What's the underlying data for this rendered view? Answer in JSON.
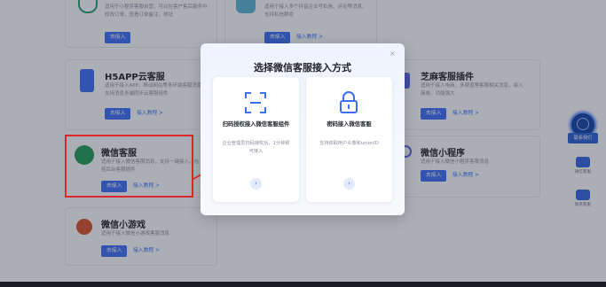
{
  "cards": {
    "top_left": {
      "desc": "适用于小程序客服自营，可以在客户售后服务中修改订单、查看订单备注、地址"
    },
    "top_mid": {
      "desc": "适用于接入多个抖音企业号私信、评论等消息，支持私信群发"
    },
    "h5app": {
      "title": "H5APP云客服",
      "desc": "适用于接入APP、移动网站等多环境客服消息，支持消息多端同步云客服组件"
    },
    "zhima": {
      "title": "芝麻客服插件",
      "desc": "适用于接入电商、多渠道等客服相关消息，接入简单、功能强大"
    },
    "wechat_cs": {
      "title": "微信客服",
      "desc": "适用于接入微信客服消息，支持一键接入，包括后台客服插件"
    },
    "miniapp": {
      "title": "微信小程序",
      "desc": "适用于接入微信小程序客服消息"
    },
    "minigame": {
      "title": "微信小游戏",
      "desc": "适用于接入微信小游戏客服消息"
    },
    "btn_label": "去接入",
    "link_label": "接入教程 >"
  },
  "side": {
    "contact_label": "联系我们",
    "item1": "微信客服",
    "item2": "联系客服"
  },
  "modal": {
    "title": "选择微信客服接入方式",
    "close": "×",
    "option1": {
      "title": "扫码授权接入微信客服组件",
      "desc": "企业管理员扫码授权后，1分钟即可接入",
      "go": "›"
    },
    "option2": {
      "title": "密码接入微信客服",
      "desc": "支持获取用户头像和unionID",
      "go": "›"
    }
  },
  "colors": {
    "accent": "#3a6ff7",
    "highlight": "#e0262a"
  }
}
